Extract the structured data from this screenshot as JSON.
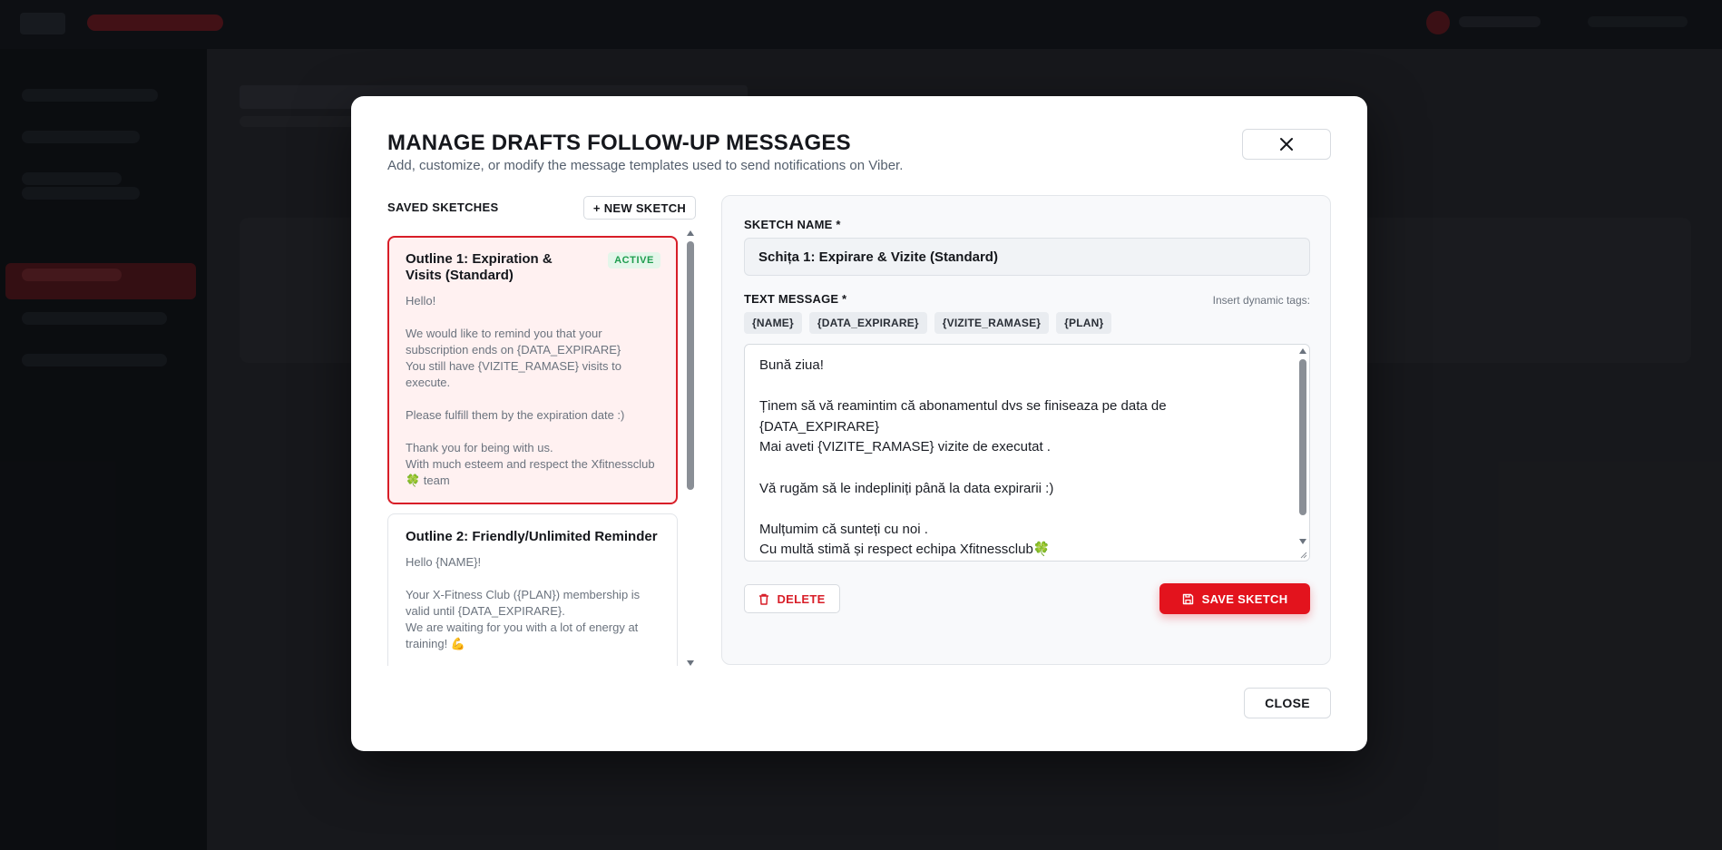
{
  "colors": {
    "accent_red": "#e3131d",
    "active_border": "#d81e28",
    "active_bg": "#fff1f1",
    "badge_green": "#1e9d4e"
  },
  "modal": {
    "title": "MANAGE DRAFTS FOLLOW-UP MESSAGES",
    "subtitle": "Add, customize, or modify the message templates used to send notifications on Viber.",
    "close_icon": "close-icon",
    "footer_close": "CLOSE"
  },
  "sketches": {
    "header": "SAVED SKETCHES",
    "new_button": "+ NEW SKETCH",
    "items": [
      {
        "title": "Outline 1: Expiration & Visits (Standard)",
        "badge": "ACTIVE",
        "body": "Hello!\n\nWe would like to remind you that your subscription ends on {DATA_EXPIRARE}\nYou still have {VIZITE_RAMASE} visits to execute.\n\nPlease fulfill them by the expiration date :)\n\nThank you for being with us.\nWith much esteem and respect the Xfitnessclub🍀 team"
      },
      {
        "title": "Outline 2: Friendly/Unlimited Reminder",
        "body": "Hello {NAME}!\n\nYour X-Fitness Club ({PLAN}) membership is valid until {DATA_EXPIRARE}.\nWe are waiting for you with a lot of energy at training! 💪\n\nSincerely"
      }
    ]
  },
  "editor": {
    "name_label": "SKETCH NAME *",
    "name_value": "Schița 1: Expirare & Vizite (Standard)",
    "message_label": "TEXT MESSAGE *",
    "insert_hint": "Insert dynamic tags:",
    "tags": [
      "{NAME}",
      "{DATA_EXPIRARE}",
      "{VIZITE_RAMASE}",
      "{PLAN}"
    ],
    "message": "Bună ziua!\n\nȚinem să vă reamintim că abonamentul dvs se finiseaza pe data de {DATA_EXPIRARE}\nMai aveti {VIZITE_RAMASE} vizite de executat .\n\nVă rugăm să le indepliniți până la data expirarii :)\n\nMulțumim că sunteți cu noi .\nCu multă stimă și respect echipa Xfitnessclub🍀",
    "delete_label": "DELETE",
    "delete_icon": "trash-icon",
    "save_label": "SAVE SKETCH",
    "save_icon": "floppy-disk-icon"
  }
}
